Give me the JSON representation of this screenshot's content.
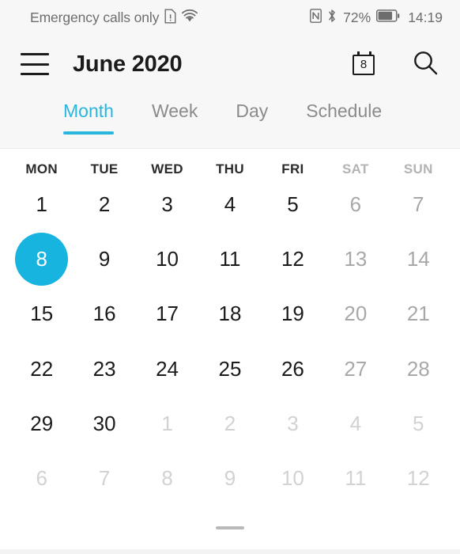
{
  "status_bar": {
    "carrier": "Emergency calls only",
    "sim_icon": "sim-alert-icon",
    "wifi_icon": "wifi-icon",
    "nfc_icon": "nfc-icon",
    "bluetooth_icon": "bluetooth-icon",
    "battery_percent": "72%",
    "battery_icon": "battery-icon",
    "time": "14:19"
  },
  "header": {
    "menu_icon": "hamburger-menu-icon",
    "title": "June 2020",
    "today_icon": "calendar-today-icon",
    "today_icon_day": "8",
    "search_icon": "search-icon"
  },
  "tabs": {
    "active": "Month",
    "items": [
      {
        "label": "Month"
      },
      {
        "label": "Week"
      },
      {
        "label": "Day"
      },
      {
        "label": "Schedule"
      }
    ]
  },
  "calendar": {
    "weekdays": [
      {
        "label": "MON",
        "weekend": false
      },
      {
        "label": "TUE",
        "weekend": false
      },
      {
        "label": "WED",
        "weekend": false
      },
      {
        "label": "THU",
        "weekend": false
      },
      {
        "label": "FRI",
        "weekend": false
      },
      {
        "label": "SAT",
        "weekend": true
      },
      {
        "label": "SUN",
        "weekend": true
      }
    ],
    "weeks": [
      [
        {
          "day": "1",
          "state": "current"
        },
        {
          "day": "2",
          "state": "current"
        },
        {
          "day": "3",
          "state": "current"
        },
        {
          "day": "4",
          "state": "current"
        },
        {
          "day": "5",
          "state": "current"
        },
        {
          "day": "6",
          "state": "weekend"
        },
        {
          "day": "7",
          "state": "weekend"
        }
      ],
      [
        {
          "day": "8",
          "state": "today"
        },
        {
          "day": "9",
          "state": "current"
        },
        {
          "day": "10",
          "state": "current"
        },
        {
          "day": "11",
          "state": "current"
        },
        {
          "day": "12",
          "state": "current"
        },
        {
          "day": "13",
          "state": "weekend"
        },
        {
          "day": "14",
          "state": "weekend"
        }
      ],
      [
        {
          "day": "15",
          "state": "current"
        },
        {
          "day": "16",
          "state": "current"
        },
        {
          "day": "17",
          "state": "current"
        },
        {
          "day": "18",
          "state": "current"
        },
        {
          "day": "19",
          "state": "current"
        },
        {
          "day": "20",
          "state": "weekend"
        },
        {
          "day": "21",
          "state": "weekend"
        }
      ],
      [
        {
          "day": "22",
          "state": "current"
        },
        {
          "day": "23",
          "state": "current"
        },
        {
          "day": "24",
          "state": "current"
        },
        {
          "day": "25",
          "state": "current"
        },
        {
          "day": "26",
          "state": "current"
        },
        {
          "day": "27",
          "state": "weekend"
        },
        {
          "day": "28",
          "state": "weekend"
        }
      ],
      [
        {
          "day": "29",
          "state": "current"
        },
        {
          "day": "30",
          "state": "current"
        },
        {
          "day": "1",
          "state": "other"
        },
        {
          "day": "2",
          "state": "other"
        },
        {
          "day": "3",
          "state": "other"
        },
        {
          "day": "4",
          "state": "other"
        },
        {
          "day": "5",
          "state": "other"
        }
      ],
      [
        {
          "day": "6",
          "state": "other"
        },
        {
          "day": "7",
          "state": "other"
        },
        {
          "day": "8",
          "state": "other"
        },
        {
          "day": "9",
          "state": "other"
        },
        {
          "day": "10",
          "state": "other"
        },
        {
          "day": "11",
          "state": "other"
        },
        {
          "day": "12",
          "state": "other"
        }
      ]
    ]
  },
  "bottom": {
    "home_indicator": "home-gesture-indicator"
  },
  "colors": {
    "accent": "#18b4e0",
    "tab_active": "#29b6dd",
    "text_primary": "#1b1b1b",
    "text_muted": "#a8a8a8",
    "text_other_month": "#d2d2d2",
    "header_bg": "#f7f7f7"
  }
}
